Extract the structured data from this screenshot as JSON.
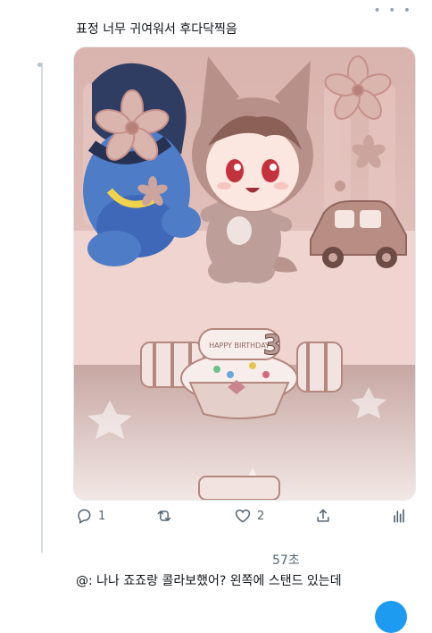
{
  "tweet": {
    "text": "표정 너무 귀여워서 후다닥찍음",
    "more_icon": "ellipsis-icon",
    "actions": {
      "reply_count": "1",
      "retweet_count": "",
      "like_count": "2"
    }
  },
  "reply": {
    "timestamp": "57초",
    "text": "@: 나나 죠죠랑 콜라보했어? 왼쪽에 스탠드 있는데"
  },
  "media": {
    "cake_sign_text": "HAPPY BIRTHDAY",
    "cake_number": "3"
  },
  "colors": {
    "accent": "#1d9bf0",
    "icon_gray": "#536471"
  }
}
